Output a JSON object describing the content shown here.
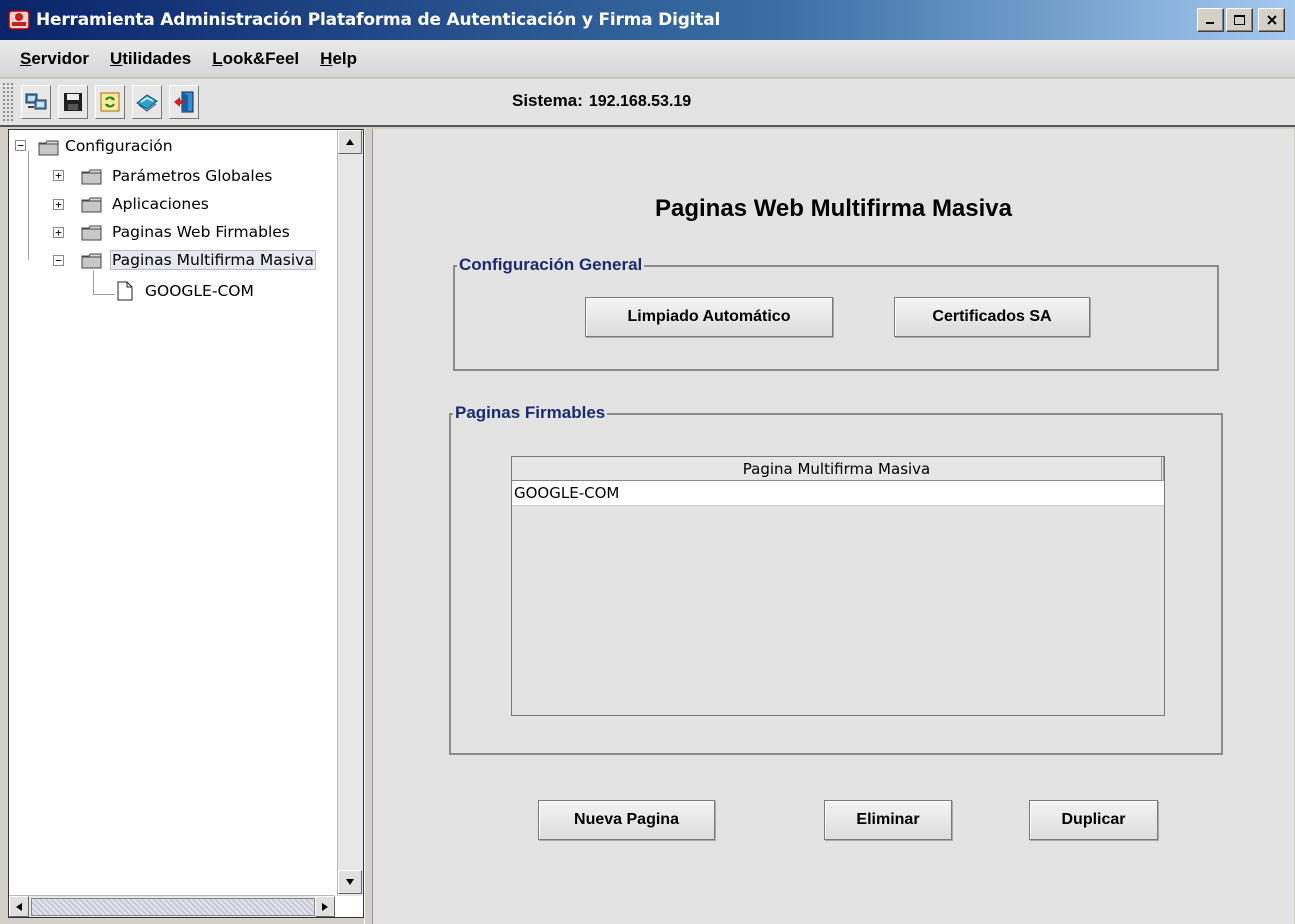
{
  "window": {
    "title": "Herramienta Administración Plataforma de Autenticación y Firma Digital"
  },
  "menu": {
    "items": [
      {
        "u": "S",
        "rest": "ervidor"
      },
      {
        "u": "U",
        "rest": "tilidades"
      },
      {
        "u": "L",
        "rest": "ook&Feel"
      },
      {
        "u": "H",
        "rest": "elp"
      }
    ]
  },
  "toolbar": {
    "sistema_label": "Sistema:",
    "sistema_value": "192.168.53.19"
  },
  "tree": {
    "root": "Configuración",
    "nodes": [
      "Parámetros Globales",
      "Aplicaciones",
      "Paginas Web Firmables",
      "Paginas Multifirma Masiva"
    ],
    "leaf": "GOOGLE-COM",
    "root_expander": "−",
    "expanders": [
      "+",
      "+",
      "+",
      "−"
    ]
  },
  "main": {
    "title": "Paginas Web Multifirma Masiva",
    "config_group": {
      "legend": "Configuración General",
      "btn_limpiado": "Limpiado Automático",
      "btn_certificados": "Certificados SA"
    },
    "pages_group": {
      "legend": "Paginas Firmables",
      "column_header": "Pagina Multifirma Masiva",
      "rows": [
        "GOOGLE-COM"
      ]
    },
    "btn_nueva": "Nueva Pagina",
    "btn_eliminar": "Eliminar",
    "btn_duplicar": "Duplicar"
  }
}
